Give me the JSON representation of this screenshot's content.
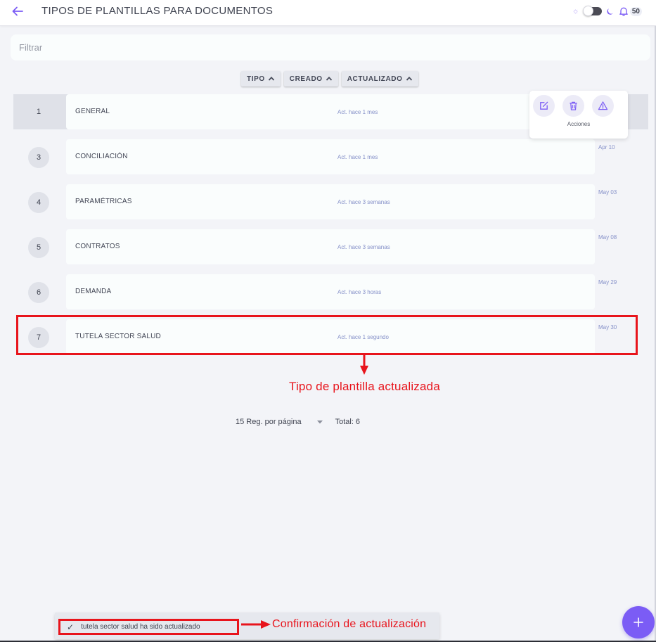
{
  "header": {
    "title": "TIPOS DE PLANTILLAS PARA DOCUMENTOS",
    "notifications_count": "50"
  },
  "filter": {
    "placeholder": "Filtrar"
  },
  "sort": {
    "tipo": "TIPO",
    "creado": "CREADO",
    "actualizado": "ACTUALIZADO"
  },
  "rows": [
    {
      "num": "1",
      "name": "GENERAL",
      "updated": "Act. hace 1 mes",
      "date": ""
    },
    {
      "num": "3",
      "name": "CONCILIACIÓN",
      "updated": "Act. hace 1 mes",
      "date": "Apr 10"
    },
    {
      "num": "4",
      "name": "PARAMÉTRICAS",
      "updated": "Act. hace 3 semanas",
      "date": "May 03"
    },
    {
      "num": "5",
      "name": "CONTRATOS",
      "updated": "Act. hace 3 semanas",
      "date": "May 08"
    },
    {
      "num": "6",
      "name": "DEMANDA",
      "updated": "Act. hace 3 horas",
      "date": "May 29"
    },
    {
      "num": "7",
      "name": "TUTELA SECTOR SALUD",
      "updated": "Act. hace 1 segundo",
      "date": "May 30"
    }
  ],
  "actions": {
    "label": "Acciones"
  },
  "annotations": {
    "updated_type": "Tipo de plantilla actualizada",
    "confirmation": "Confirmación de actualización"
  },
  "pagination": {
    "per_page": "15 Reg. por página",
    "total": "Total: 6"
  },
  "toast": {
    "message": "tutela sector salud ha sido actualizado"
  },
  "colors": {
    "accent": "#7b5cf5",
    "annotation_red": "#e8141c",
    "row_meta": "#8590c8"
  },
  "icons": {
    "back": "arrow-left-icon",
    "theme_light": "sun-icon",
    "theme_dark": "moon-icon",
    "notifications": "bell-icon",
    "edit": "edit-icon",
    "delete": "trash-icon",
    "warning": "warning-icon",
    "confirm": "check-icon",
    "add": "plus-icon"
  }
}
